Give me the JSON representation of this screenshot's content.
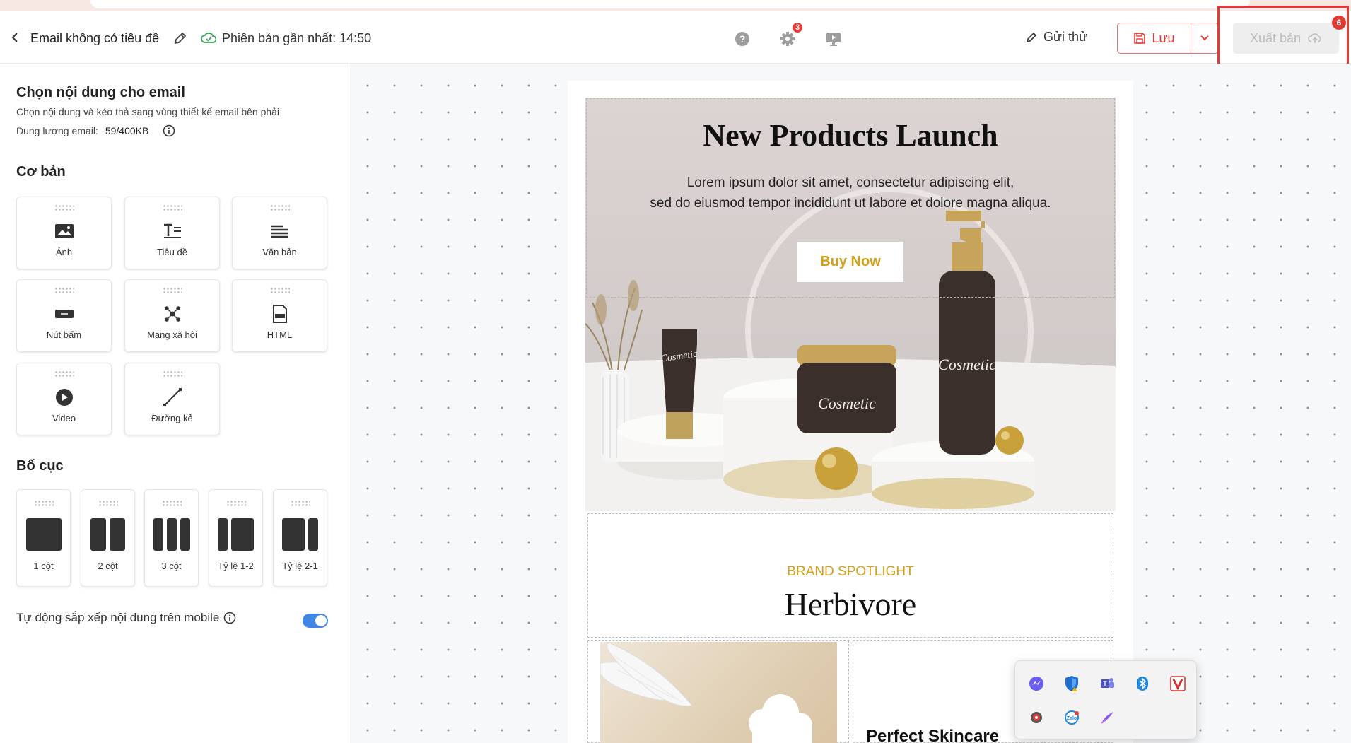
{
  "header": {
    "title": "Email không có tiêu đề",
    "version": "Phiên bản gần nhất: 14:50",
    "settings_badge": "3",
    "send_test": "Gửi thử",
    "save": "Lưu",
    "publish": "Xuất bản",
    "notification_badge": "6"
  },
  "sidebar": {
    "title": "Chọn nội dung cho email",
    "subtitle": "Chọn nội dung và kéo thả sang vùng thiết kế email bên phải",
    "size_label": "Dung lượng email:",
    "size_value": "59/400KB",
    "basic_heading": "Cơ bản",
    "basic_items": [
      {
        "label": "Ảnh",
        "icon": "image-icon"
      },
      {
        "label": "Tiêu đề",
        "icon": "heading-icon"
      },
      {
        "label": "Văn bản",
        "icon": "text-icon"
      },
      {
        "label": "Nút bấm",
        "icon": "button-icon"
      },
      {
        "label": "Mạng xã hội",
        "icon": "social-icon"
      },
      {
        "label": "HTML",
        "icon": "html-icon"
      },
      {
        "label": "Video",
        "icon": "video-icon"
      },
      {
        "label": "Đường kẻ",
        "icon": "divider-icon"
      }
    ],
    "layout_heading": "Bố cục",
    "layout_items": [
      {
        "label": "1 cột"
      },
      {
        "label": "2 cột"
      },
      {
        "label": "3 cột"
      },
      {
        "label": "Tỷ lệ 1-2"
      },
      {
        "label": "Tỷ lệ 2-1"
      }
    ],
    "auto_arrange": "Tự động sắp xếp nội dung trên mobile",
    "auto_arrange_on": true
  },
  "email": {
    "hero_title": "New Products Launch",
    "hero_text_1": "Lorem ipsum dolor sit amet, consectetur adipiscing elit,",
    "hero_text_2": "sed do eiusmod tempor incididunt ut labore et dolore magna aliqua.",
    "buy_button": "Buy Now",
    "product_brand": "Cosmetic",
    "brand_tag": "BRAND SPOTLIGHT",
    "brand_name": "Herbivore",
    "skincare_title": "Perfect Skincare"
  },
  "tray_icons": [
    "messenger-icon",
    "windows-security-icon",
    "teams-icon",
    "bluetooth-icon",
    "antivirus-icon",
    "snipping-icon",
    "zalo-icon",
    "pen-icon"
  ],
  "colors": {
    "accent_red": "#e53935",
    "gold": "#d4a017",
    "toggle_blue": "#3f86e5"
  }
}
